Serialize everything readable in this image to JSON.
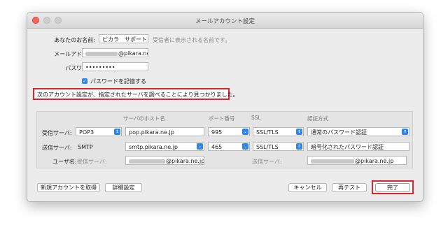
{
  "window": {
    "title": "メールアカウント設定"
  },
  "form": {
    "name_label": "あなたのお名前:",
    "name_value": "ピカラ　サポート",
    "name_hint": "受信者に表示される名前です。",
    "email_label": "メールアドレス:",
    "email_suffix": "@pikara.ne.jp",
    "password_label": "パスワード:",
    "password_value": "•••••••••",
    "remember_label": "パスワードを記憶する",
    "remember_checked": "✓"
  },
  "notice": "次のアカウント設定が、指定されたサーバを調べることにより見つかりました。",
  "server_table": {
    "headers": {
      "host": "サーバのホスト名",
      "port": "ポート番号",
      "ssl": "SSL",
      "auth": "認証方式"
    },
    "incoming": {
      "label": "受信サーバ:",
      "protocol": "POP3",
      "host": "pop.pikara.ne.jp",
      "port": "995",
      "ssl": "SSL/TLS",
      "auth": "通常のパスワード認証"
    },
    "outgoing": {
      "label": "送信サーバ:",
      "protocol": "SMTP",
      "host": "smtp.pikara.ne.jp",
      "port": "465",
      "ssl": "SSL/TLS",
      "auth": "暗号化されたパスワード認証"
    },
    "username": {
      "label": "ユーザ名:",
      "incoming_label": "受信サーバ:",
      "incoming_suffix": "@pikara.ne.jp",
      "outgoing_label": "送信サーバ:",
      "outgoing_suffix": "@pikara.ne.jp"
    }
  },
  "buttons": {
    "new_account": "新規アカウントを取得",
    "advanced": "詳細設定",
    "cancel": "キャンセル",
    "retest": "再テスト",
    "done": "完了"
  },
  "icons": {
    "arrow": "⌄",
    "updown": "⇕"
  },
  "colors": {
    "accent": "#2d84f0",
    "highlight": "#e4222a"
  }
}
